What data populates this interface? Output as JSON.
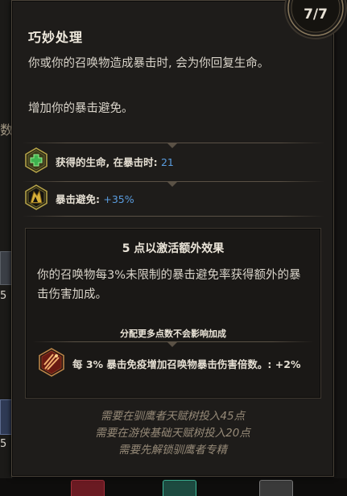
{
  "tooltip": {
    "title": "巧妙处理",
    "rank": "7/7",
    "description_1": "你或你的召唤物造成暴击时, 会为你回复生命。",
    "description_2": "增加你的暴击避免。",
    "stats": [
      {
        "icon": "health-cross-icon",
        "label": "获得的生命, 在暴击时: ",
        "value": "21"
      },
      {
        "icon": "crit-avoid-icon",
        "label": "暴击避免: ",
        "value": "+35%"
      }
    ],
    "bonus": {
      "heading": "5 点以激活额外效果",
      "description": "你的召唤物每3%未限制的暴击避免率获得额外的暴击伤害加成。",
      "note": "分配更多点数不会影响加成",
      "effect": "每 3% 暴击免疫增加召唤物暴击伤害倍数。: +2%",
      "icon": "claw-strike-icon"
    },
    "requirements": [
      "需要在驯鹰者天赋树投入45点",
      "需要在游侠基础天赋树投入20点",
      "需要先解锁驯鹰者专精"
    ]
  },
  "background": {
    "fragment_text": "数",
    "slot_values": [
      "5",
      "5"
    ]
  },
  "colors": {
    "value_blue": "#5a9de0",
    "panel_bg": "#1e1c1a",
    "border_gold": "#5a5145",
    "requirement_text": "#968a78"
  }
}
